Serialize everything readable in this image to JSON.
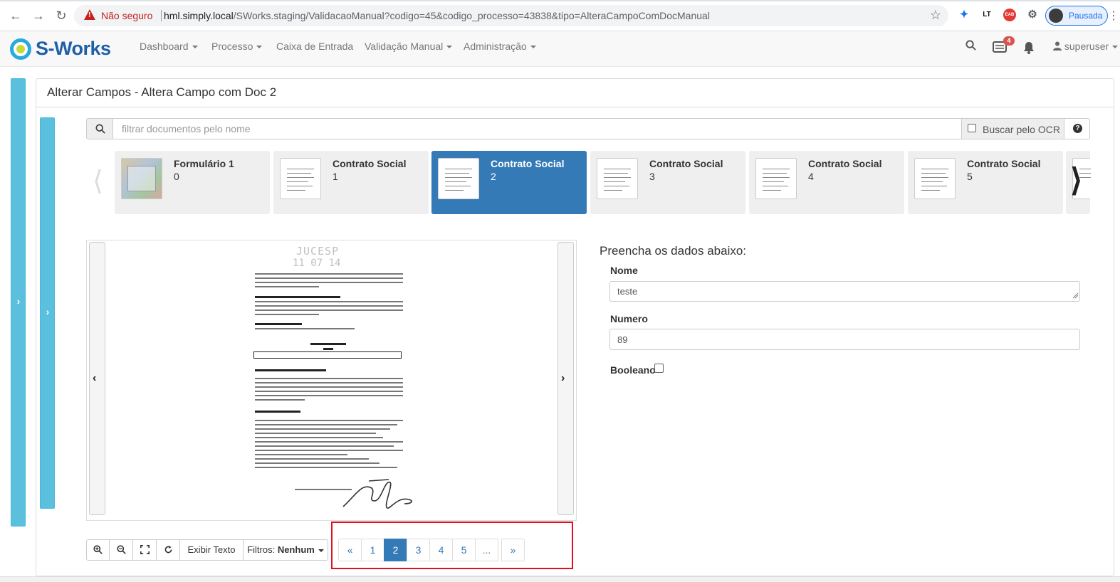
{
  "browser": {
    "not_secure": "Não seguro",
    "url_host": "hml.simply.local",
    "url_path": "/SWorks.staging/ValidacaoManual?codigo=45&codigo_processo=43838&tipo=AlteraCampoComDocManual",
    "profile_label": "Pausada",
    "ext_lt": "LT",
    "ext_eab": "EAB"
  },
  "navbar": {
    "brand": "S-Works",
    "items": [
      {
        "label": "Dashboard",
        "dropdown": true
      },
      {
        "label": "Processo",
        "dropdown": true
      },
      {
        "label": "Caixa de Entrada",
        "dropdown": false
      },
      {
        "label": "Validação Manual",
        "dropdown": true
      },
      {
        "label": "Administração",
        "dropdown": true
      }
    ],
    "notification_count": "4",
    "user": "superuser"
  },
  "panel": {
    "title": "Alterar Campos - Altera Campo com Doc 2"
  },
  "search": {
    "placeholder": "filtrar documentos pelo nome",
    "ocr_label": "Buscar pelo OCR"
  },
  "documents": [
    {
      "name": "Formulário 1",
      "index": "0",
      "active": false,
      "thumb": "photo"
    },
    {
      "name": "Contrato Social",
      "index": "1",
      "active": false,
      "thumb": "text"
    },
    {
      "name": "Contrato Social",
      "index": "2",
      "active": true,
      "thumb": "text"
    },
    {
      "name": "Contrato Social",
      "index": "3",
      "active": false,
      "thumb": "text"
    },
    {
      "name": "Contrato Social",
      "index": "4",
      "active": false,
      "thumb": "text"
    },
    {
      "name": "Contrato Social",
      "index": "5",
      "active": false,
      "thumb": "text"
    }
  ],
  "viewer": {
    "stamp": "JUCESP",
    "stamp_date": "11 07 14"
  },
  "toolbar": {
    "exibir_texto": "Exibir Texto",
    "filtros_label": "Filtros:",
    "filtros_value": "Nenhum"
  },
  "pagination": {
    "prev": "«",
    "pages": [
      "1",
      "2",
      "3",
      "4",
      "5"
    ],
    "current": "2",
    "ellipsis": "...",
    "next": "»"
  },
  "form": {
    "heading": "Preencha os dados abaixo:",
    "nome_label": "Nome",
    "nome_value": "teste",
    "numero_label": "Numero",
    "numero_value": "89",
    "booleano_label": "Booleano"
  },
  "colors": {
    "primary": "#337ab7",
    "info": "#5bc0de",
    "highlight": "#e0101e"
  }
}
